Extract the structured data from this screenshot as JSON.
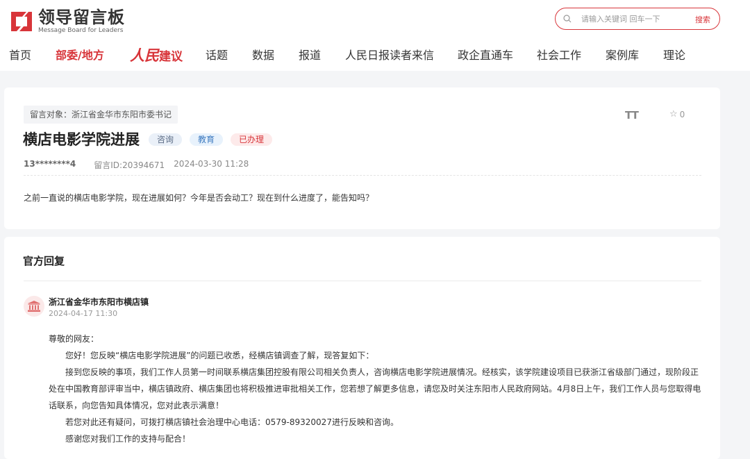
{
  "logo": {
    "cn": "领导留言板",
    "en": "Message Board for Leaders"
  },
  "search": {
    "placeholder": "请输入关键词 回车一下",
    "button": "搜索"
  },
  "nav": {
    "home": "首页",
    "ministries": "部委/地方",
    "renmin_script": "人民",
    "renmin_text": "建议",
    "topics": "话题",
    "data": "数据",
    "reports": "报道",
    "letters": "人民日报读者来信",
    "gov_enterprise": "政企直通车",
    "social_work": "社会工作",
    "cases": "案例库",
    "theory": "理论"
  },
  "message": {
    "target": "留言对象：浙江省金华市东阳市委书记",
    "title": "横店电影学院进展",
    "tags": [
      "咨询",
      "教育",
      "已办理"
    ],
    "user": "13********4",
    "msg_id": "留言ID:20394671",
    "date": "2024-03-30 11:28",
    "body": "之前一直说的横店电影学院，现在进展如何？今年是否会动工？现在到什么进度了，能告知吗？",
    "font_tool": "TT",
    "likes": "0"
  },
  "reply": {
    "section_title": "官方回复",
    "org": "浙江省金华市东阳市横店镇",
    "date": "2024-04-17 11:30",
    "paragraphs": [
      "尊敬的网友：",
      "您好！您反映“横店电影学院进展”的问题已收悉，经横店镇调查了解，现答复如下：",
      "接到您反映的事项，我们工作人员第一时间联系横店集团控股有限公司相关负责人，咨询横店电影学院进展情况。经核实，该学院建设项目已获浙江省级部门通过，现阶段正处在中国教育部评审当中，横店镇政府、横店集团也将积极推进审批相关工作，您若想了解更多信息，请您及时关注东阳市人民政府网站。4月8日上午，我们工作人员与您取得电话联系，向您告知具体情况，您对此表示满意！",
      "若您对此还有疑问，可拨打横店镇社会治理中心电话：0579-89320027进行反映和咨询。",
      "感谢您对我们工作的支持与配合！"
    ]
  },
  "colors": {
    "accent": "#d8353a",
    "background": "#f4f5f7"
  }
}
